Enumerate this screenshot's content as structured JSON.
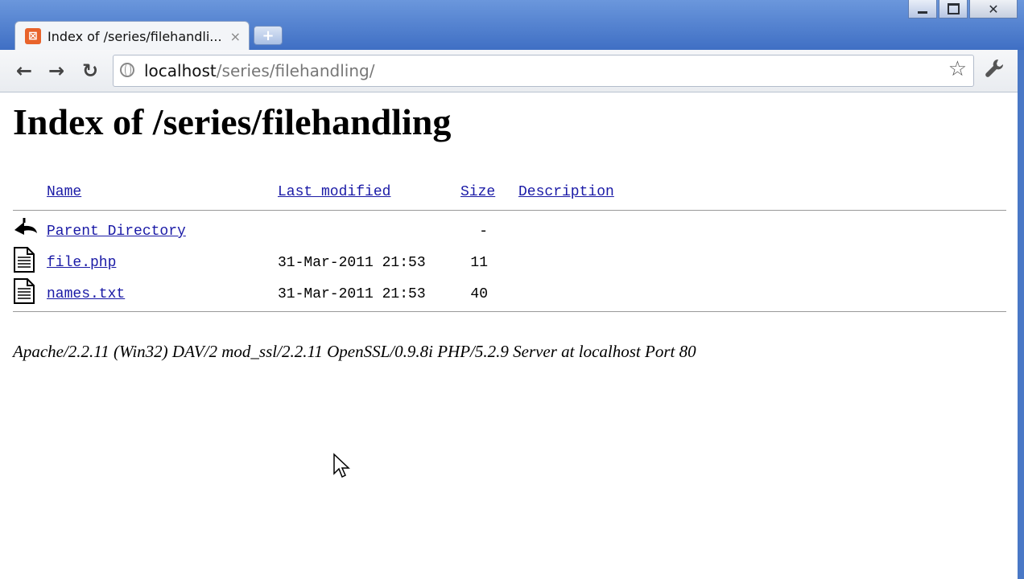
{
  "tab": {
    "title": "Index of /series/filehandli...",
    "close": "×"
  },
  "newtab": {
    "label": "+"
  },
  "window": {
    "minimize": "",
    "maximize": "",
    "close": "✕"
  },
  "toolbar": {
    "back": "←",
    "forward": "→",
    "reload": "↻",
    "url_host": "localhost",
    "url_path": "/series/filehandling/",
    "star": "☆",
    "wrench": "🔧"
  },
  "page": {
    "heading": "Index of /series/filehandling",
    "columns": {
      "name": "Name",
      "modified": "Last modified",
      "size": "Size",
      "description": "Description"
    },
    "rows": [
      {
        "name": "Parent Directory",
        "modified": "",
        "size": "-",
        "icon": "back-arrow-icon"
      },
      {
        "name": "file.php",
        "modified": "31-Mar-2011 21:53",
        "size": "11",
        "icon": "file-icon"
      },
      {
        "name": "names.txt",
        "modified": "31-Mar-2011 21:53",
        "size": "40",
        "icon": "file-icon"
      }
    ],
    "footer": "Apache/2.2.11 (Win32) DAV/2 mod_ssl/2.2.11 OpenSSL/0.9.8i PHP/5.2.9 Server at localhost Port 80"
  },
  "colors": {
    "link": "#1a1aa6",
    "favicon": "#e8632b",
    "frame": "#4a78c6"
  }
}
